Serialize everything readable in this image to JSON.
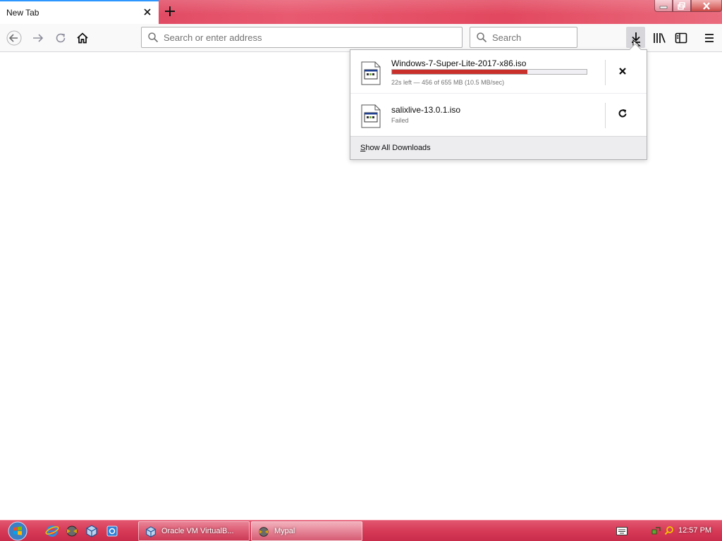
{
  "browser": {
    "tab": {
      "title": "New Tab"
    },
    "urlbar": {
      "placeholder": "Search or enter address"
    },
    "searchbar": {
      "placeholder": "Search"
    }
  },
  "downloads_panel": {
    "items": [
      {
        "filename": "Windows-7-Super-Lite-2017-x86.iso",
        "status": "22s left — 456 of 655 MB (10.5 MB/sec)",
        "progress_fraction": 0.696,
        "action_icon": "cancel-icon"
      },
      {
        "filename": "salixlive-13.0.1.iso",
        "status": "Failed",
        "action_icon": "retry-icon"
      }
    ],
    "show_all_accesskey": "S",
    "show_all_rest": "how All Downloads"
  },
  "taskbar": {
    "buttons": [
      {
        "label": "Oracle VM VirtualB..."
      },
      {
        "label": "Mypal"
      }
    ],
    "clock": "12:57 PM"
  },
  "colors": {
    "accent": "#0a84ff",
    "progress": "#c9302c",
    "titlebar": "#e2485f",
    "taskbar": "#d63a57"
  }
}
